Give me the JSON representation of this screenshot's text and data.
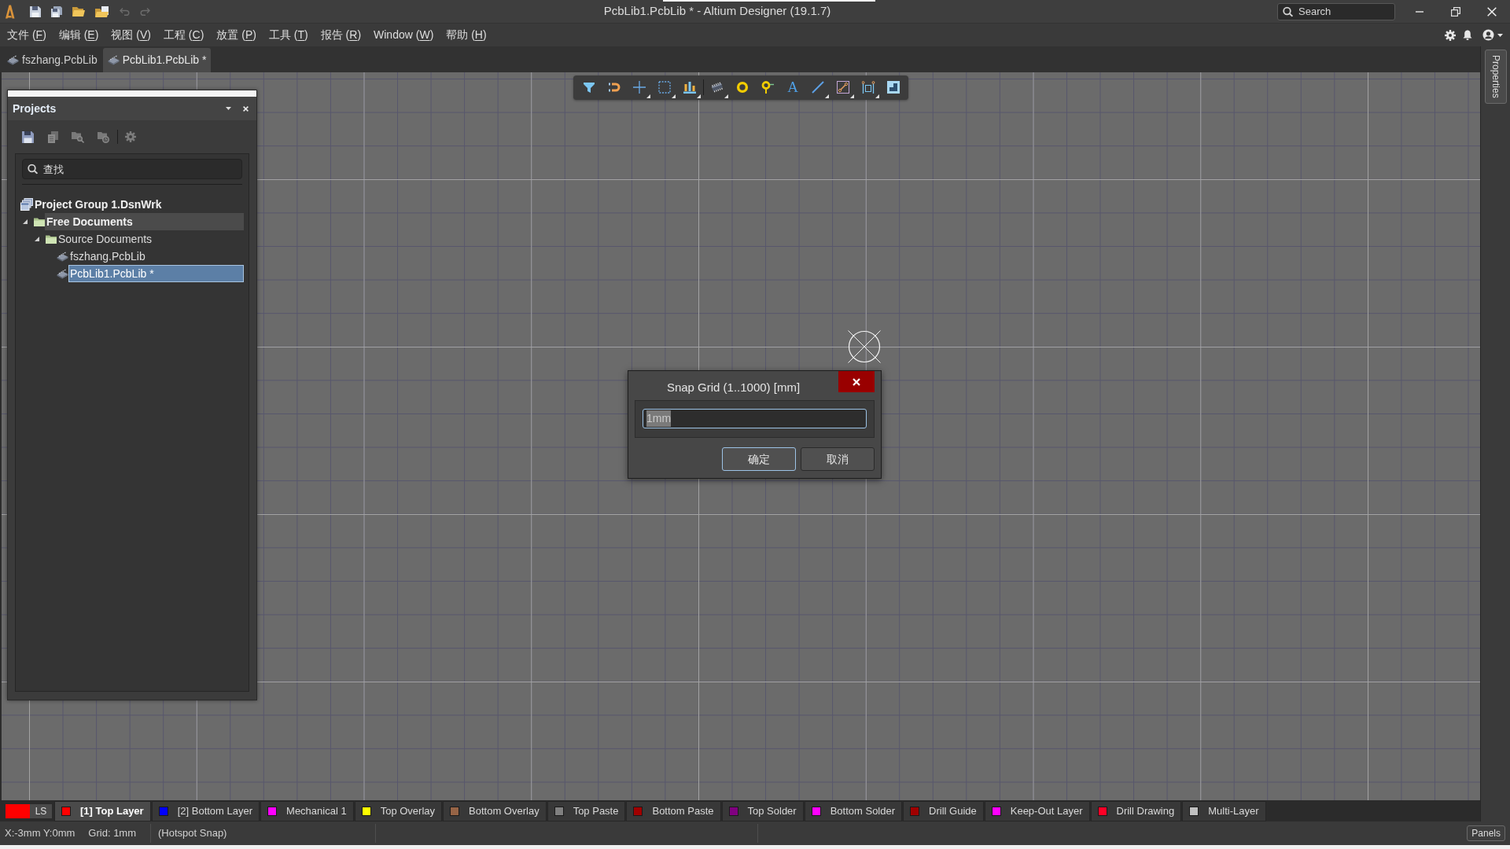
{
  "title_bar": {
    "title": "PcbLib1.PcbLib * - Altium Designer (19.1.7)",
    "undo": {
      "disabled": true
    },
    "redo": {
      "disabled": true
    },
    "search": {
      "placeholder": "Search"
    }
  },
  "menu_bar": {
    "items": [
      {
        "before": "文件 (",
        "accel": "F",
        "after": ")"
      },
      {
        "before": "编辑 (",
        "accel": "E",
        "after": ")"
      },
      {
        "before": "视图 (",
        "accel": "V",
        "after": ")"
      },
      {
        "before": "工程 (",
        "accel": "C",
        "after": ")"
      },
      {
        "before": "放置 (",
        "accel": "P",
        "after": ")"
      },
      {
        "before": "工具 (",
        "accel": "T",
        "after": ")"
      },
      {
        "before": "报告 (",
        "accel": "R",
        "after": ")"
      },
      {
        "before": "Window (",
        "accel": "W",
        "after": ")"
      },
      {
        "before": "帮助 (",
        "accel": "H",
        "after": ")"
      }
    ]
  },
  "document_tabs": [
    {
      "label": "fszhang.PcbLib",
      "selected": false
    },
    {
      "label": "PcbLib1.PcbLib *",
      "selected": true
    }
  ],
  "canvas_toolbar": {
    "text_tool": "A"
  },
  "projects_panel": {
    "title": "Projects",
    "search": {
      "placeholder": "查找"
    },
    "tree": [
      {
        "label": "Project Group 1.DsnWrk",
        "kind": "workspace",
        "selected": false,
        "highlighted": false,
        "children": [
          {
            "label": "Free Documents",
            "kind": "project",
            "expanded": true,
            "selected": false,
            "highlighted": true,
            "children": [
              {
                "label": "Source Documents",
                "kind": "folder",
                "expanded": true,
                "selected": false,
                "highlighted": false,
                "children": [
                  {
                    "label": "fszhang.PcbLib",
                    "kind": "document",
                    "selected": false,
                    "highlighted": false
                  },
                  {
                    "label": "PcbLib1.PcbLib *",
                    "kind": "document",
                    "selected": true,
                    "highlighted": false
                  }
                ]
              }
            ]
          }
        ]
      }
    ]
  },
  "dialog": {
    "title": "Snap Grid (1..1000) [mm]",
    "field": {
      "value": "1mm",
      "text_selected": true
    },
    "buttons": [
      {
        "label": "确定",
        "default": true
      },
      {
        "label": "取消",
        "default": false
      }
    ]
  },
  "layer_bar": {
    "layer_set_label": "LS",
    "layers": [
      {
        "label": "[1] Top Layer",
        "color": "#ff0000",
        "selected": true
      },
      {
        "label": "[2] Bottom Layer",
        "color": "#0000ff",
        "selected": false
      },
      {
        "label": "Mechanical 1",
        "color": "#ff00ff",
        "selected": false
      },
      {
        "label": "Top Overlay",
        "color": "#ffff00",
        "selected": false
      },
      {
        "label": "Bottom Overlay",
        "color": "#966446",
        "selected": false
      },
      {
        "label": "Top Paste",
        "color": "#808080",
        "selected": false
      },
      {
        "label": "Bottom Paste",
        "color": "#a00000",
        "selected": false
      },
      {
        "label": "Top Solder",
        "color": "#800080",
        "selected": false
      },
      {
        "label": "Bottom Solder",
        "color": "#ff00ff",
        "selected": false
      },
      {
        "label": "Drill Guide",
        "color": "#a00000",
        "selected": false
      },
      {
        "label": "Keep-Out Layer",
        "color": "#ff00ff",
        "selected": false
      },
      {
        "label": "Drill Drawing",
        "color": "#ff0026",
        "selected": false
      },
      {
        "label": "Multi-Layer",
        "color": "#c0c0c0",
        "selected": false
      }
    ]
  },
  "status_bar": {
    "items": [
      "X:-3mm Y:0mm",
      "Grid: 1mm",
      "(Hotspot Snap)"
    ],
    "panels_button": "Panels"
  },
  "properties_tab": {
    "label": "Properties"
  }
}
